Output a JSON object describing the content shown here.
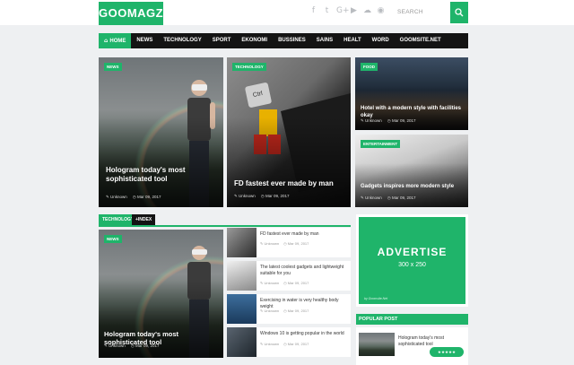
{
  "header": {
    "logo": "GOOMAGZ",
    "social_icons": [
      "facebook-icon",
      "twitter-icon",
      "google-plus-icon",
      "youtube-icon",
      "soundcloud-icon",
      "rss-icon"
    ],
    "search_placeholder": "SEARCH"
  },
  "nav": {
    "items": [
      "HOME",
      "NEWS",
      "TECHNOLOGY",
      "SPORT",
      "EKONOMI",
      "BUSSINES",
      "SAINS",
      "HEALT",
      "WORD",
      "GOOMSITE.NET"
    ]
  },
  "featured": {
    "main": {
      "badge": "NEWS",
      "title": "Hologram today's most sophisticated tool",
      "author": "Unknown",
      "date": "Mar 09, 2017"
    },
    "middle": {
      "badge": "TECHNOLOGY",
      "title": "FD fastest ever made by man",
      "author": "Unknown",
      "date": "Mar 09, 2017",
      "key_label": "Ctrl"
    },
    "right_top": {
      "badge": "FOOD",
      "title": "Hotel with a modern style with facilities okay",
      "author": "Unknown",
      "date": "Mar 09, 2017"
    },
    "right_bottom": {
      "badge": "ENTERTAINMENT",
      "title": "Gadgets inspires more modern style",
      "author": "Unknown",
      "date": "Mar 09, 2017"
    }
  },
  "section": {
    "tab_label": "TECHNOLOGY",
    "index_label": "+INDEX",
    "main": {
      "badge": "NEWS",
      "title": "Hologram today's most sophisticated tool",
      "author": "Unknown",
      "date": "Mar 09, 2017"
    },
    "list": [
      {
        "title": "FD fastest ever made by man",
        "author": "Unknown",
        "date": "Mar 09, 2017"
      },
      {
        "title": "The latest coolest gadgets and lightweight suitable for you",
        "author": "Unknown",
        "date": "Mar 09, 2017"
      },
      {
        "title": "Exercising in water is very healthy body weight",
        "author": "Unknown",
        "date": "Mar 09, 2017"
      },
      {
        "title": "Windows 10 is getting popular in the world",
        "author": "Unknown",
        "date": "Mar 09, 2017"
      }
    ]
  },
  "sidebar": {
    "ad_title": "ADVERTISE",
    "ad_size": "300 x 250",
    "ad_credit": "by Goomsite.Net",
    "popular_heading": "POPULAR POST",
    "popular": {
      "title": "Hologram today's most sophisticated tool",
      "rating": "★★★★★"
    }
  },
  "icons": {
    "author": "✎",
    "date": "◷"
  },
  "colors": {
    "accent": "#1fb46a",
    "nav": "#141414"
  }
}
